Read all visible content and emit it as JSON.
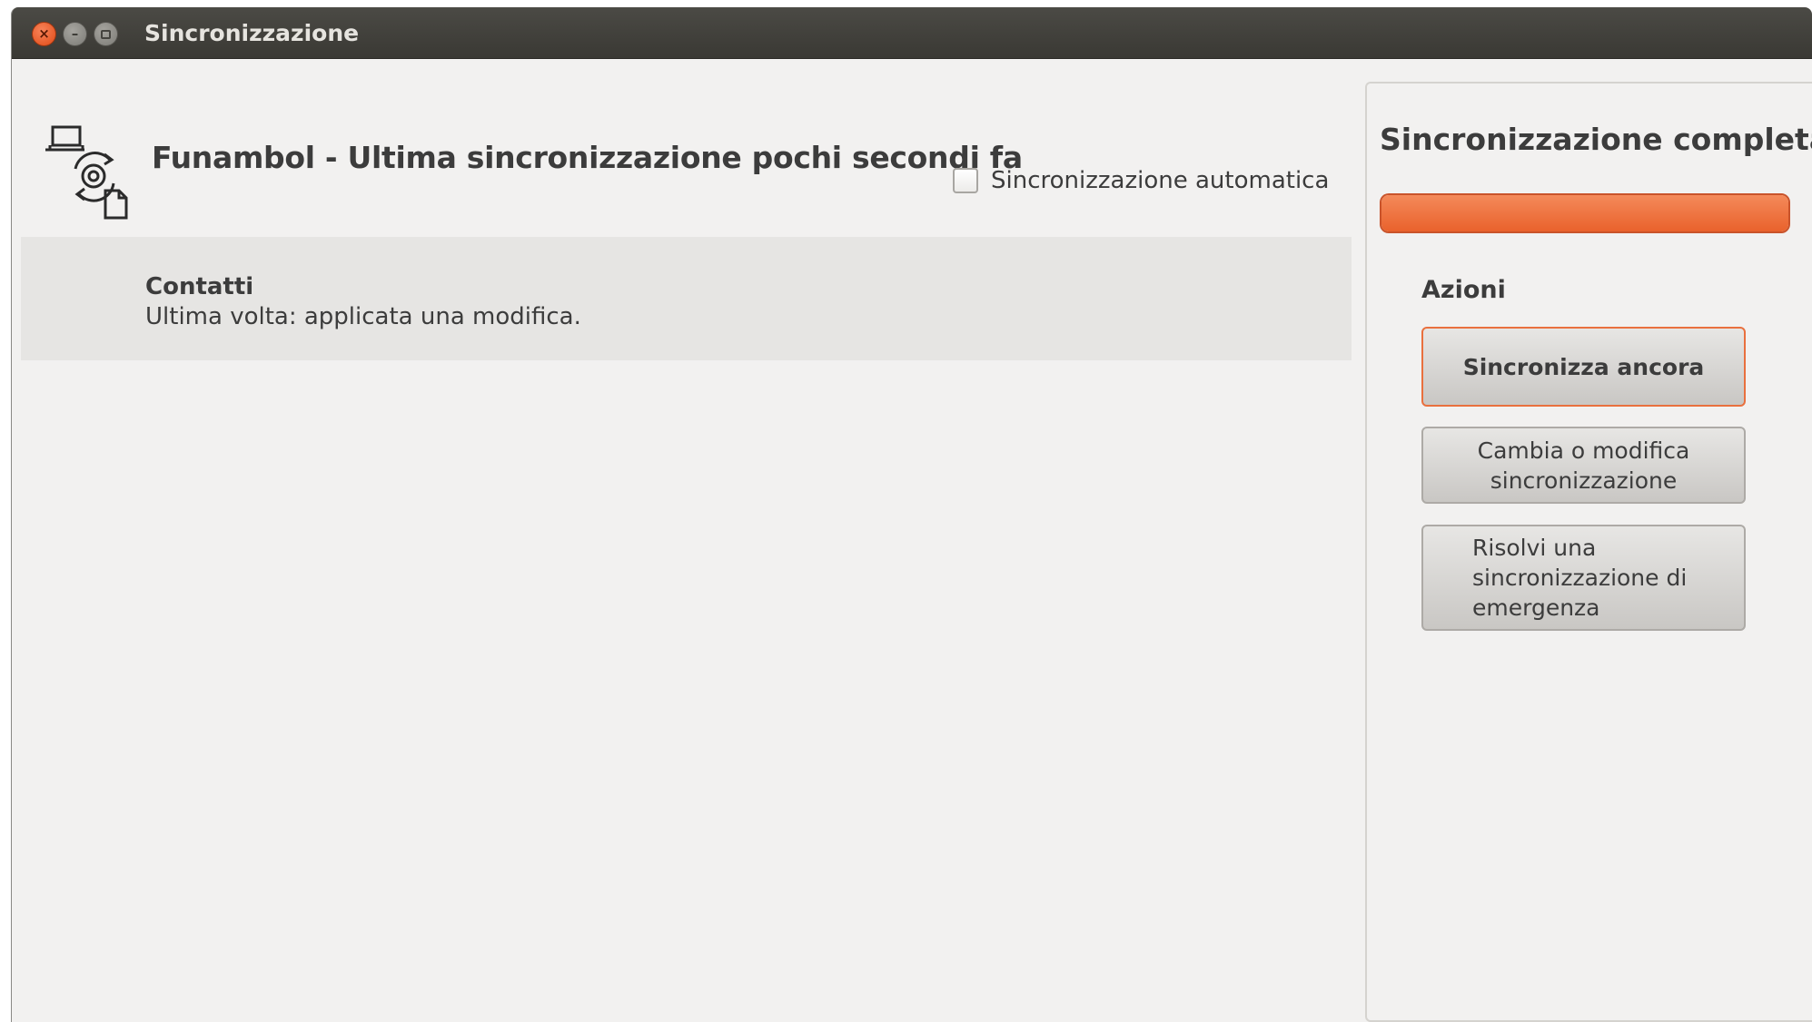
{
  "window": {
    "title": "Sincronizzazione",
    "controls": [
      "close-icon",
      "minimize-icon",
      "maximize-icon"
    ]
  },
  "header": {
    "icon": "sync-devices-icon",
    "profile_title": "Funambol - Ultima sincronizzazione pochi secondi fa",
    "auto_sync_label": "Sincronizzazione automatica",
    "auto_sync_checked": false
  },
  "sources": [
    {
      "name": "Contatti",
      "status": "Ultima volta: applicata una modifica."
    }
  ],
  "side_panel": {
    "status_title": "Sincronizzazione completata",
    "progress": 1.0,
    "actions_label": "Azioni",
    "buttons": {
      "sync_again": "Sincronizza ancora",
      "change_sync": "Cambia o modifica sincronizzazione",
      "emergency_sync": "Risolvi una sincronizzazione di emergenza"
    }
  },
  "colors": {
    "accent": "#e9622c",
    "titlebar": "#3c3b37",
    "background": "#f2f1f0"
  }
}
